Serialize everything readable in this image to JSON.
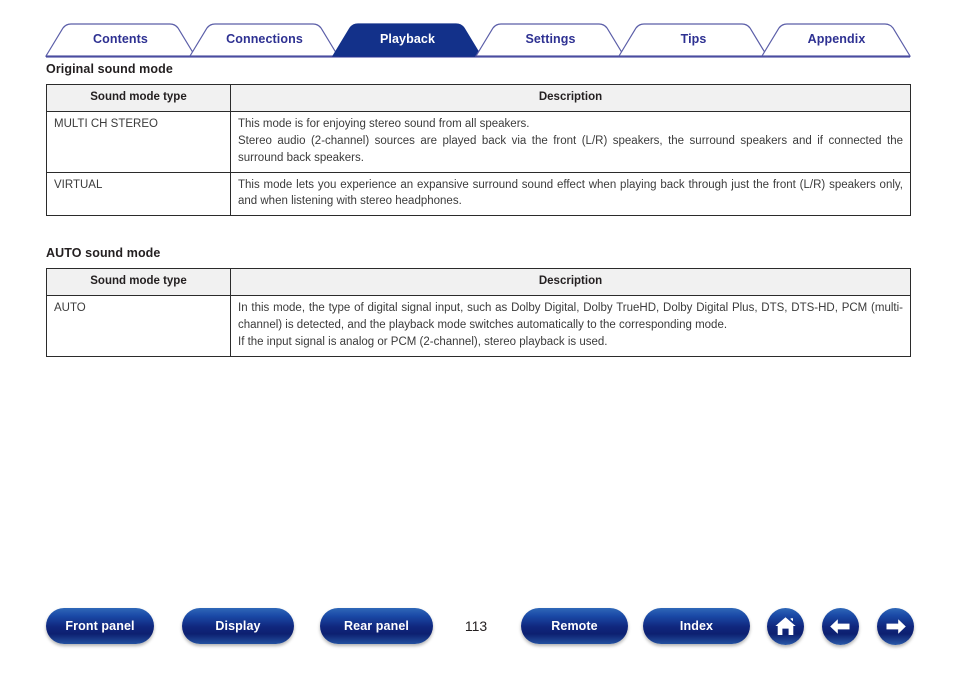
{
  "nav": {
    "tabs": [
      {
        "label": "Contents",
        "active": false
      },
      {
        "label": "Connections",
        "active": false
      },
      {
        "label": "Playback",
        "active": true
      },
      {
        "label": "Settings",
        "active": false
      },
      {
        "label": "Tips",
        "active": false
      },
      {
        "label": "Appendix",
        "active": false
      }
    ],
    "active_tab": "Playback",
    "accent_color": "#2e3192",
    "active_tab_color": "#13318a"
  },
  "sections": [
    {
      "title": "Original sound mode",
      "table": {
        "headers": [
          "Sound mode type",
          "Description"
        ],
        "rows": [
          {
            "type": "MULTI CH STEREO",
            "lines": [
              "This mode is for enjoying stereo sound from all speakers.",
              "Stereo audio (2-channel) sources are played back via the front (L/R) speakers, the surround speakers and if connected the surround back speakers."
            ]
          },
          {
            "type": "VIRTUAL",
            "lines": [
              "This mode lets you experience an expansive surround sound effect when playing back through just the front (L/R) speakers only, and when listening with stereo headphones."
            ]
          }
        ]
      }
    },
    {
      "title": "AUTO sound mode",
      "table": {
        "headers": [
          "Sound mode type",
          "Description"
        ],
        "rows": [
          {
            "type": "AUTO",
            "lines": [
              "In this mode, the type of digital signal input, such as Dolby Digital, Dolby TrueHD, Dolby Digital Plus, DTS, DTS-HD, PCM (multi-channel) is detected, and the playback mode switches automatically to the corresponding mode.",
              "If the input signal is analog or PCM (2-channel), stereo playback is used."
            ]
          }
        ]
      }
    }
  ],
  "footer": {
    "buttons": [
      {
        "label": "Front panel"
      },
      {
        "label": "Display"
      },
      {
        "label": "Rear panel"
      },
      {
        "label": "Remote"
      },
      {
        "label": "Index"
      }
    ],
    "page_number": "113",
    "icons": [
      {
        "name": "home-icon"
      },
      {
        "name": "arrow-left-icon"
      },
      {
        "name": "arrow-right-icon"
      }
    ],
    "button_color": "#13318a"
  }
}
